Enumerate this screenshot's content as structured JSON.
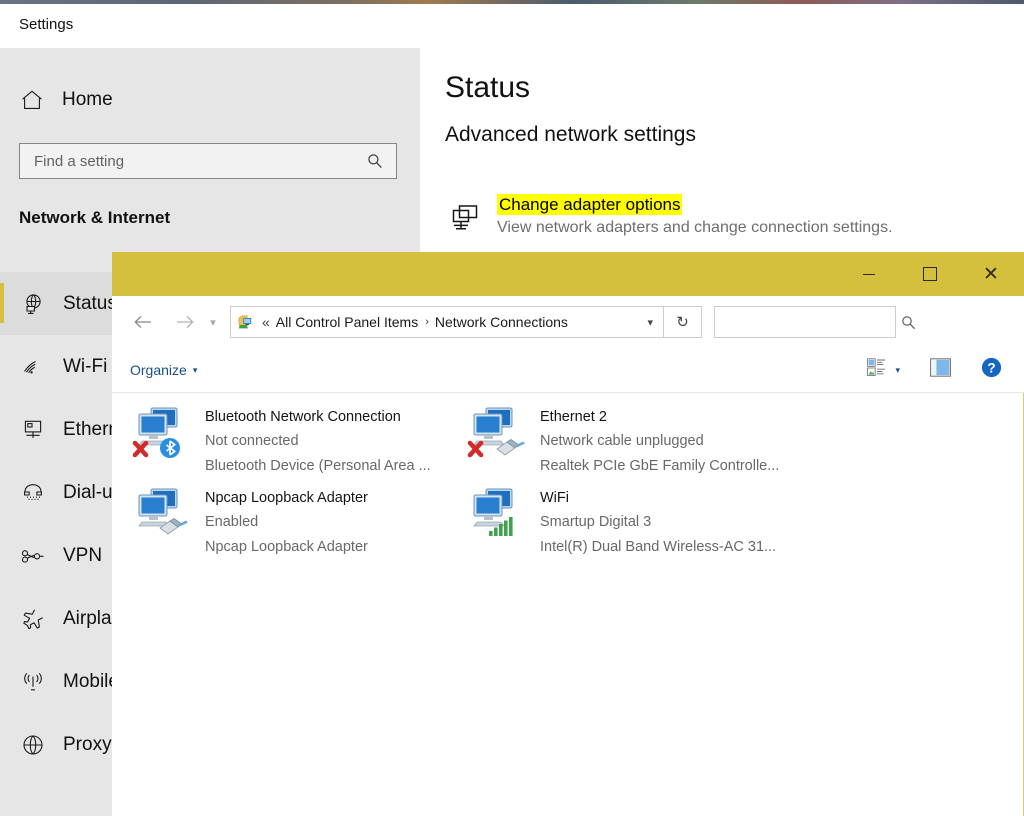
{
  "settings": {
    "window_title": "Settings",
    "titlebar_buttons": [
      {
        "name": "minimize",
        "glyph": "minimize-icon"
      },
      {
        "name": "maximize",
        "glyph": "maximize-icon"
      },
      {
        "name": "close",
        "glyph": "close-icon"
      }
    ],
    "home_label": "Home",
    "search": {
      "placeholder": "Find a setting",
      "value": "",
      "icon": "search-icon"
    },
    "category_title": "Network & Internet",
    "nav_items": [
      {
        "label": "Status",
        "icon": "status-globe-icon",
        "selected": true
      },
      {
        "label": "Wi-Fi",
        "icon": "wifi-icon",
        "selected": false
      },
      {
        "label": "Ethernet",
        "icon": "ethernet-icon",
        "selected": false
      },
      {
        "label": "Dial-up",
        "icon": "dialup-icon",
        "selected": false
      },
      {
        "label": "VPN",
        "icon": "vpn-icon",
        "selected": false
      },
      {
        "label": "Airplane mode",
        "icon": "airplane-icon",
        "selected": false
      },
      {
        "label": "Mobile hotspot",
        "icon": "mobile-hotspot-icon",
        "selected": false
      },
      {
        "label": "Proxy",
        "icon": "proxy-globe-icon",
        "selected": false
      }
    ],
    "page": {
      "heading": "Status",
      "subheading": "Advanced network settings",
      "change_adapter_link": "Change adapter options",
      "change_adapter_desc": "View network adapters and change connection settings.",
      "change_adapter_icon": "network-adapter-icon",
      "highlight_color": "#ffff00"
    }
  },
  "explorer": {
    "accent_color": "#d4c03c",
    "titlebar_buttons": [
      {
        "name": "minimize",
        "glyph": "minimize-icon"
      },
      {
        "name": "maximize",
        "glyph": "maximize-icon"
      },
      {
        "name": "close",
        "glyph": "close-icon"
      }
    ],
    "nav": {
      "back_icon": "arrow-left-icon",
      "forward_icon": "arrow-right-icon",
      "recent_icon": "chevron-down-icon"
    },
    "address": {
      "icon": "control-panel-icon",
      "leading_separator": "«",
      "crumbs": [
        "All Control Panel Items",
        "Network Connections"
      ],
      "crumb_separator": "›",
      "dropdown_icon": "chevron-down-icon",
      "refresh_icon": "refresh-icon"
    },
    "search": {
      "value": "",
      "placeholder": "",
      "icon": "search-icon"
    },
    "toolbar": {
      "organize_label": "Organize",
      "organize_caret": "▾",
      "view_options_icon": "view-options-icon",
      "view_caret": "▾",
      "preview_pane_icon": "preview-pane-icon",
      "help_icon": "help-icon"
    },
    "adapters": [
      {
        "name": "Bluetooth Network Connection",
        "status": "Not connected",
        "device": "Bluetooth Device (Personal Area ...",
        "icon": "network-adapter-bluetooth-disconnected-icon",
        "badge": "bluetooth",
        "disconnected": true
      },
      {
        "name": "Ethernet 2",
        "status": "Network cable unplugged",
        "device": "Realtek PCIe GbE Family Controlle...",
        "icon": "network-adapter-ethernet-unplugged-icon",
        "badge": "rj45",
        "disconnected": true
      },
      {
        "name": "Npcap Loopback Adapter",
        "status": "Enabled",
        "device": "Npcap Loopback Adapter",
        "icon": "network-adapter-enabled-icon",
        "badge": "rj45",
        "disconnected": false
      },
      {
        "name": "WiFi",
        "status": "Smartup Digital 3",
        "device": "Intel(R) Dual Band Wireless-AC 31...",
        "icon": "network-adapter-wifi-connected-icon",
        "badge": "signal",
        "disconnected": false
      }
    ]
  }
}
